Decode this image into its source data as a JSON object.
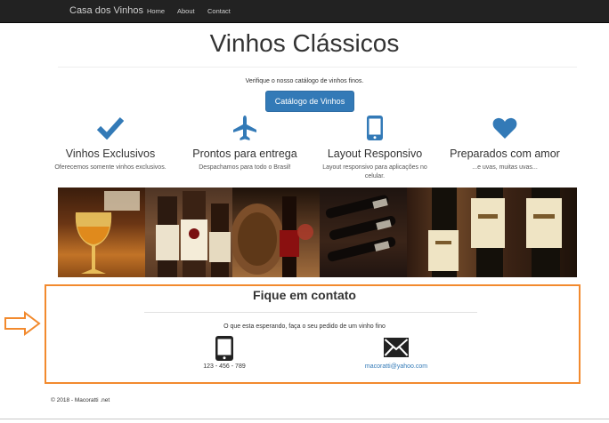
{
  "navbar": {
    "brand": "Casa dos Vinhos",
    "links": [
      "Home",
      "About",
      "Contact"
    ]
  },
  "hero": {
    "title": "Vinhos Clássicos",
    "tagline": "Verifique o nosso catálogo de vinhos finos.",
    "button_label": "Catálogo de Vinhos"
  },
  "features": [
    {
      "icon": "checkmark-icon",
      "title": "Vinhos Exclusivos",
      "desc": "Oferecemos somente vinhos exclusivos."
    },
    {
      "icon": "airplane-icon",
      "title": "Prontos para entrega",
      "desc": "Despachamos para todo o Brasil!"
    },
    {
      "icon": "mobile-phone-icon",
      "title": "Layout Responsivo",
      "desc": "Layout responsivo para aplicações no celular."
    },
    {
      "icon": "heart-icon",
      "title": "Preparados com amor",
      "desc": "...e uvas, muitas uvas..."
    }
  ],
  "contact": {
    "title": "Fique em contato",
    "text": "O que esta esperando, faça o seu pedido de um vinho fino",
    "phone": "123 - 456 - 789",
    "email": "macoratti@yahoo.com"
  },
  "footer": {
    "copyright": "© 2018 - Macoratti .net"
  },
  "colors": {
    "navbar": "#222222",
    "primary": "#337ab7",
    "highlight": "#f28a2e"
  }
}
